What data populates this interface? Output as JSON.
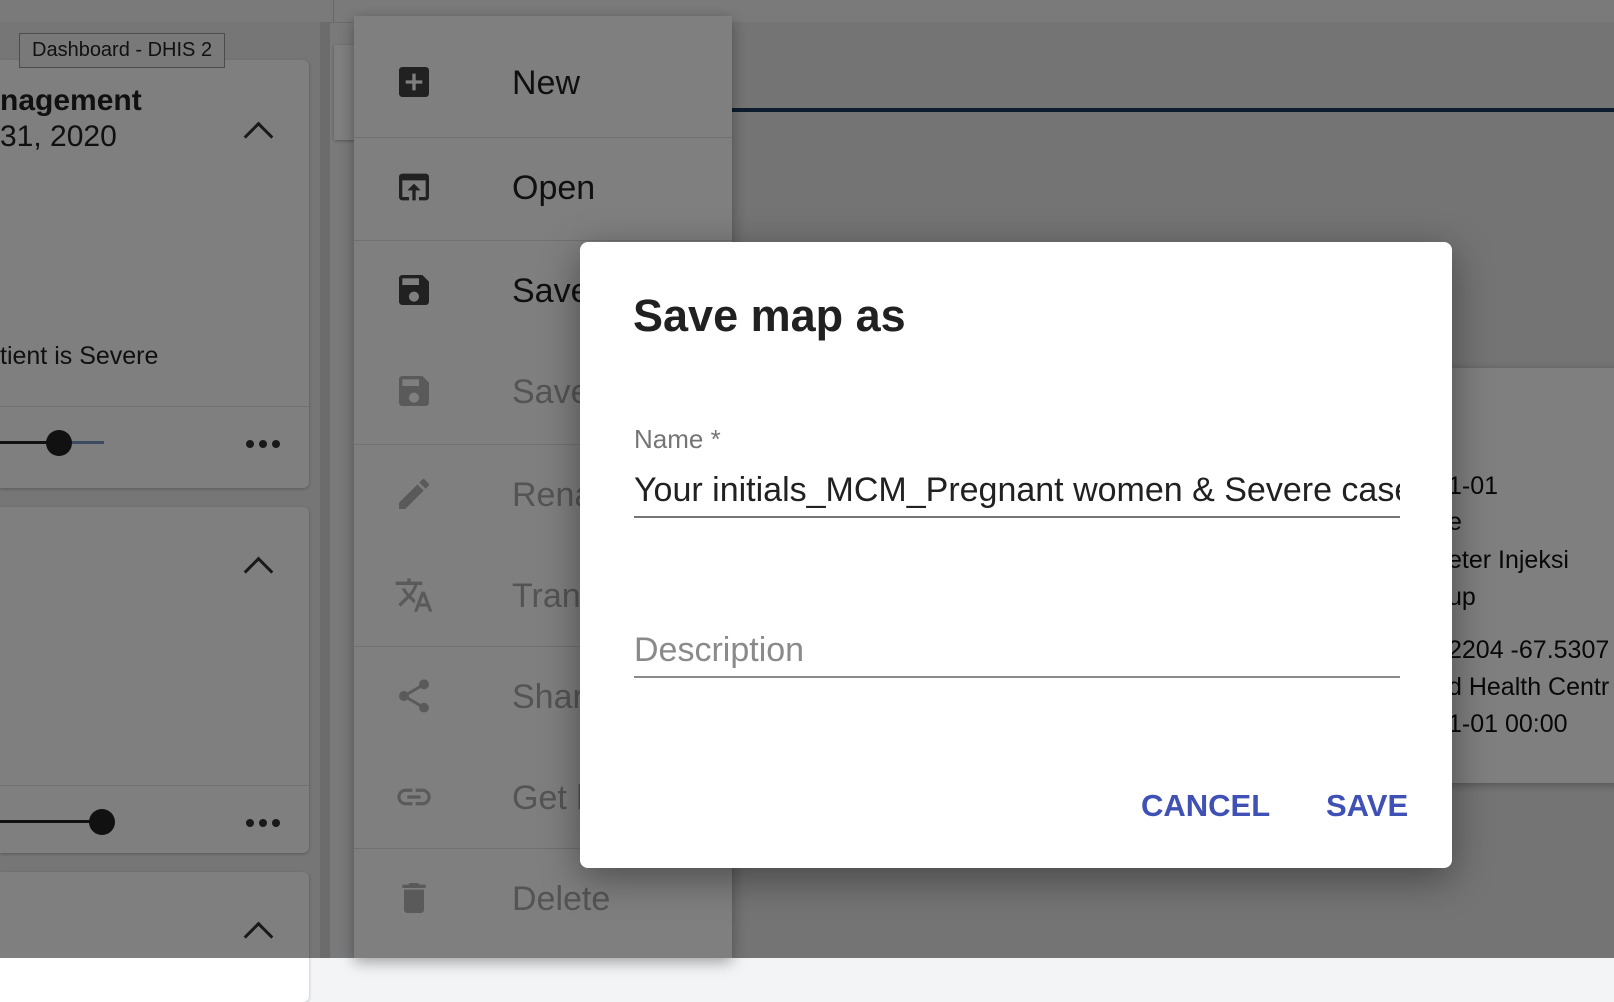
{
  "tooltip": {
    "text": "Dashboard - DHIS 2"
  },
  "left_panel": {
    "card1": {
      "title": "nagement",
      "date": "31, 2020",
      "text": "tient is Severe"
    }
  },
  "file_menu": {
    "items": [
      {
        "label": "New",
        "icon": "add-box-icon",
        "enabled": true
      },
      {
        "label": "Open",
        "icon": "open-in-browser-icon",
        "enabled": true
      },
      {
        "label": "Save",
        "icon": "save-icon",
        "enabled": true
      },
      {
        "label": "Save as...",
        "icon": "save-as-icon",
        "enabled": false
      },
      {
        "label": "Rename",
        "icon": "pencil-icon",
        "enabled": false
      },
      {
        "label": "Translate",
        "icon": "translate-icon",
        "enabled": false
      },
      {
        "label": "Share",
        "icon": "share-icon",
        "enabled": false
      },
      {
        "label": "Get link",
        "icon": "link-icon",
        "enabled": false
      },
      {
        "label": "Delete",
        "icon": "trash-icon",
        "enabled": false
      }
    ]
  },
  "map_popup": {
    "lines": [
      "1-01",
      "e",
      "eter Injeksi",
      "up",
      "2204 -67.5307",
      "d Health Centr",
      "1-01 00:00"
    ]
  },
  "dialog": {
    "title": "Save map as",
    "name_label": "Name *",
    "name_value": "Your initials_MCM_Pregnant women & Severe cases",
    "description_placeholder": "Description",
    "cancel_label": "CANCEL",
    "save_label": "SAVE"
  },
  "colors": {
    "accent": "#3f51b5",
    "overlay": "rgba(0,0,0,0.5)"
  }
}
